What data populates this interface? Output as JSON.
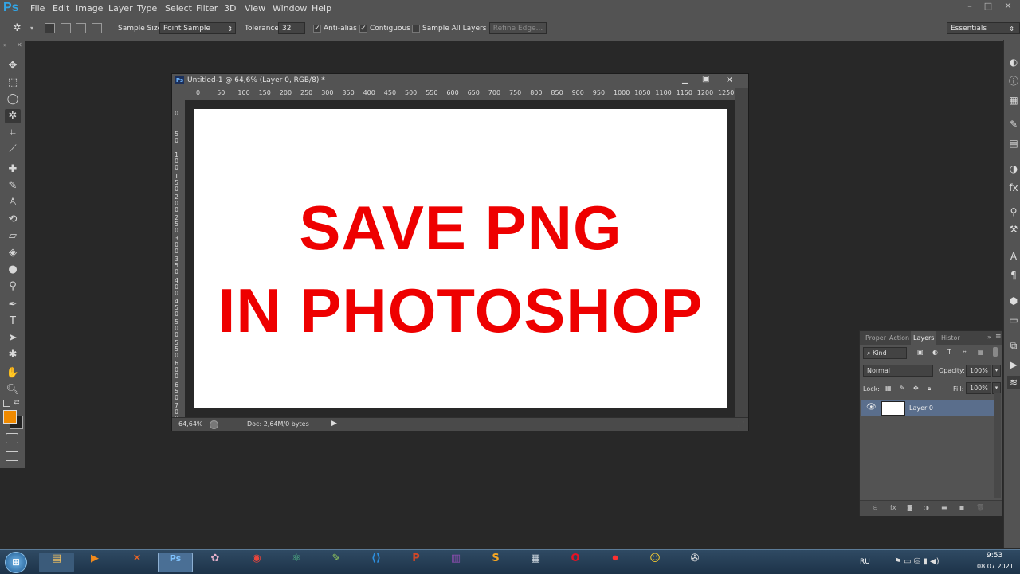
{
  "app": {
    "logo": "Ps",
    "menu": [
      "File",
      "Edit",
      "Image",
      "Layer",
      "Type",
      "Select",
      "Filter",
      "3D",
      "View",
      "Window",
      "Help"
    ],
    "window_controls": [
      "–",
      "□",
      "✕"
    ]
  },
  "options_bar": {
    "sample_size_label": "Sample Size:",
    "sample_size_value": "Point Sample",
    "tolerance_label": "Tolerance:",
    "tolerance_value": "32",
    "anti_alias_label": "Anti-alias",
    "anti_alias_checked": true,
    "contiguous_label": "Contiguous",
    "contiguous_checked": true,
    "sample_all_layers_label": "Sample All Layers",
    "sample_all_layers_checked": false,
    "refine_edge_label": "Refine Edge...",
    "workspace_value": "Essentials"
  },
  "tools": [
    "move-tool",
    "marquee-tool",
    "lasso-tool",
    "magic-wand-tool",
    "crop-tool",
    "eyedropper-tool",
    "spot-healing-tool",
    "brush-tool",
    "clone-stamp-tool",
    "history-brush-tool",
    "eraser-tool",
    "paint-bucket-tool",
    "blur-tool",
    "dodge-tool",
    "pen-tool",
    "type-tool",
    "path-selection-tool",
    "shape-tool",
    "hand-tool",
    "zoom-tool"
  ],
  "colors": {
    "foreground": "#f08a00",
    "background": "#222222",
    "headline": "#ee0000",
    "canvas": "#ffffff",
    "ui_gray": "#535353",
    "layer_selected": "#5a6e8c"
  },
  "document": {
    "title": "Untitled-1 @ 64,6% (Layer 0, RGB/8) *",
    "ruler_h": [
      "0",
      "50",
      "100",
      "150",
      "200",
      "250",
      "300",
      "350",
      "400",
      "450",
      "500",
      "550",
      "600",
      "650",
      "700",
      "750",
      "800",
      "850",
      "900",
      "950",
      "1000",
      "1050",
      "1100",
      "1150",
      "1200",
      "1250"
    ],
    "ruler_v": [
      "0",
      "5 0",
      "1 0 0",
      "1 5 0",
      "2 0 0",
      "2 5 0",
      "3 0 0",
      "3 5 0",
      "4 0 0",
      "4 5 0",
      "5 0 0",
      "5 5 0",
      "6 0 0",
      "6 5 0",
      "7 0 0",
      "7 5 0"
    ],
    "headline_line1": "SAVE PNG",
    "headline_line2": "IN PHOTOSHOP",
    "zoom": "64,64%",
    "doc_size": "Doc: 2,64M/0 bytes"
  },
  "layers_panel": {
    "tabs": [
      "Proper",
      "Action",
      "Layers",
      "Histor"
    ],
    "active_tab": "Layers",
    "kind_label": "Kind",
    "blend_mode": "Normal",
    "opacity_label": "Opacity:",
    "opacity_value": "100%",
    "lock_label": "Lock:",
    "fill_label": "Fill:",
    "fill_value": "100%",
    "layers": [
      {
        "name": "Layer 0",
        "visible": true,
        "selected": true
      }
    ]
  },
  "taskbar": {
    "apps": [
      "start",
      "explorer",
      "media-player",
      "xampp",
      "photoshop",
      "paint-app",
      "chrome",
      "atom",
      "notepad-plus",
      "vscode",
      "powerpoint",
      "winrar",
      "sublime",
      "calculator",
      "opera",
      "obs",
      "emoji-app",
      "film-reel"
    ],
    "language": "RU",
    "time": "9:53",
    "date": "08.07.2021"
  }
}
